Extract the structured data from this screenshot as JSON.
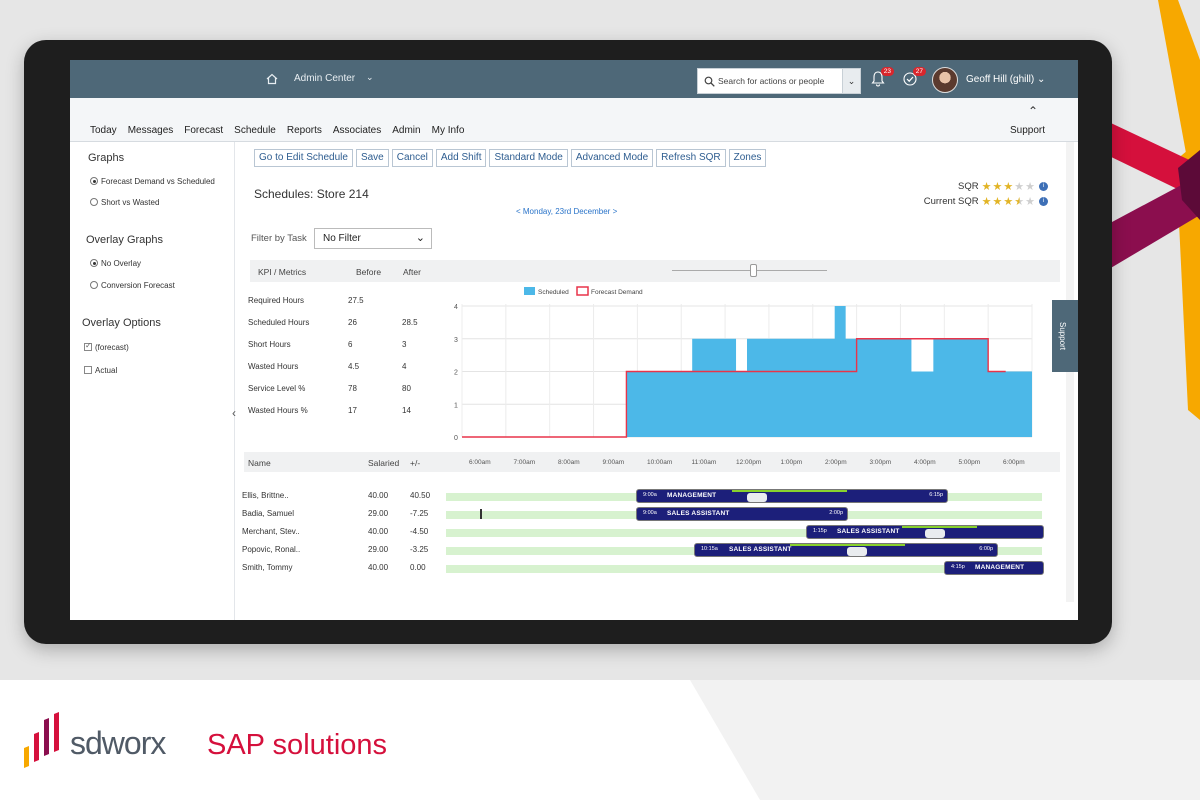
{
  "topbar": {
    "module": "Admin Center",
    "search_placeholder": "Search for actions or people",
    "notifications_count": "23",
    "approvals_count": "27",
    "user_name": "Geoff Hill (ghill)"
  },
  "menu": {
    "items": [
      "Today",
      "Messages",
      "Forecast",
      "Schedule",
      "Reports",
      "Associates",
      "Admin",
      "My Info"
    ],
    "support": "Support"
  },
  "left_panel": {
    "graphs_heading": "Graphs",
    "graph_options": [
      "Forecast Demand vs Scheduled",
      "Short vs Wasted"
    ],
    "graph_selected": "Forecast Demand vs Scheduled",
    "overlay_graphs_heading": "Overlay Graphs",
    "overlay_options": [
      "No Overlay",
      "Conversion Forecast"
    ],
    "overlay_selected": "No Overlay",
    "overlay_options_heading": "Overlay Options",
    "overlay_checks": [
      {
        "label": "(forecast)",
        "checked": true
      },
      {
        "label": "Actual",
        "checked": false
      }
    ]
  },
  "toolbar": [
    "Go to Edit Schedule",
    "Save",
    "Cancel",
    "Add Shift",
    "Standard Mode",
    "Advanced Mode",
    "Refresh SQR",
    "Zones"
  ],
  "schedule": {
    "title": "Schedules: Store 214",
    "date_nav": "< Monday, 23rd December >",
    "sqr_label": "SQR",
    "sqr_rating": 3,
    "current_sqr_label": "Current SQR",
    "current_sqr_rating": 3.5,
    "max_rating": 5
  },
  "filter": {
    "label": "Filter by Task",
    "value": "No Filter"
  },
  "kpi": {
    "headers": [
      "KPI / Metrics",
      "Before",
      "After"
    ],
    "rows": [
      {
        "metric": "Required Hours",
        "before": "27.5",
        "after": ""
      },
      {
        "metric": "Scheduled Hours",
        "before": "26",
        "after": "28.5"
      },
      {
        "metric": "Short Hours",
        "before": "6",
        "after": "3"
      },
      {
        "metric": "Wasted Hours",
        "before": "4.5",
        "after": "4"
      },
      {
        "metric": "Service Level %",
        "before": "78",
        "after": "80"
      },
      {
        "metric": "Wasted Hours %",
        "before": "17",
        "after": "14"
      }
    ]
  },
  "chart_data": {
    "type": "area",
    "legend": [
      "Scheduled",
      "Forecast Demand"
    ],
    "colors": {
      "scheduled": "#4cb8e8",
      "forecast": "#e8344a"
    },
    "x_labels": [
      "6:00am",
      "7:00am",
      "8:00am",
      "9:00am",
      "10:00am",
      "11:00am",
      "12:00pm",
      "1:00pm",
      "2:00pm",
      "3:00pm",
      "4:00pm",
      "5:00pm",
      "6:00pm"
    ],
    "y_ticks": [
      "0",
      "1",
      "2",
      "3",
      "4"
    ],
    "ylim": [
      0,
      4
    ],
    "x_range_hours": [
      6,
      19
    ],
    "scheduled_steps": [
      [
        6,
        0
      ],
      [
        9.75,
        2
      ],
      [
        11.25,
        3
      ],
      [
        12.25,
        2
      ],
      [
        12.5,
        3
      ],
      [
        14.5,
        4
      ],
      [
        14.75,
        3
      ],
      [
        18,
        2
      ],
      [
        19,
        2
      ]
    ],
    "scheduled_gaps": [
      {
        "from": 16.25,
        "to": 16.75,
        "level": 2
      }
    ],
    "forecast_steps": [
      [
        6,
        0
      ],
      [
        9.75,
        2
      ],
      [
        15.0,
        3
      ],
      [
        18.0,
        2
      ],
      [
        18.4,
        2
      ]
    ]
  },
  "grid": {
    "headers": [
      "Name",
      "Salaried",
      "+/-"
    ],
    "employees": [
      {
        "name": "Ellis, Brittne..",
        "salaried": "40.00",
        "diff": "40.50",
        "start": "9:00a",
        "role": "MANAGEMENT",
        "end": "6:15p"
      },
      {
        "name": "Badia, Samuel",
        "salaried": "29.00",
        "diff": "-7.25",
        "start": "9:00a",
        "role": "SALES ASSISTANT",
        "end": "2:00p"
      },
      {
        "name": "Merchant, Stev..",
        "salaried": "40.00",
        "diff": "-4.50",
        "start": "1:15p",
        "role": "SALES ASSISTANT",
        "end": ""
      },
      {
        "name": "Popovic, Ronal..",
        "salaried": "29.00",
        "diff": "-3.25",
        "start": "10:15a",
        "role": "SALES ASSISTANT",
        "end": "6:00p"
      },
      {
        "name": "Smith, Tommy",
        "salaried": "40.00",
        "diff": "0.00",
        "start": "4:15p",
        "role": "MANAGEMENT",
        "end": ""
      }
    ]
  },
  "support_tab": "Support",
  "brand": {
    "name": "sdworx",
    "tagline": "SAP solutions",
    "colors": {
      "red": "#d5103c",
      "grey": "#505a66",
      "orange": "#f7a800",
      "plum": "#8b0e4e"
    }
  }
}
